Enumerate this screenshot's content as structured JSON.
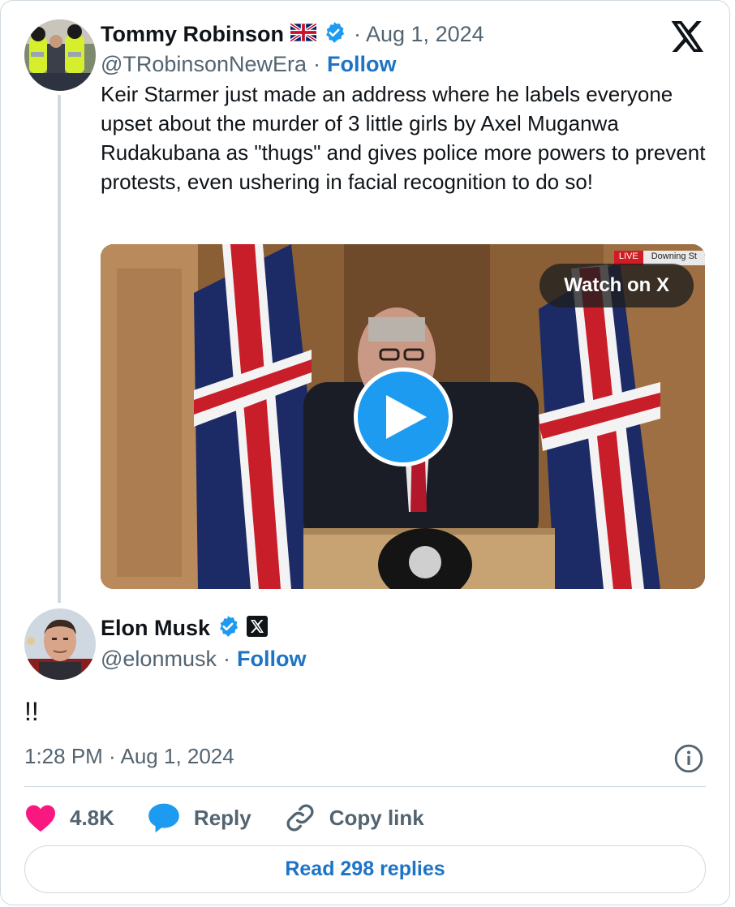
{
  "quoted_tweet": {
    "author_name": "Tommy Robinson",
    "flag_icon": "uk-flag-icon",
    "verified_icon": "verified-badge-icon",
    "date": "· Aug 1, 2024",
    "handle": "@TRobinsonNewEra",
    "separator": "·",
    "follow_label": "Follow",
    "text": "Keir Starmer just made an address where he labels everyone upset about the murder of 3 little girls by Axel Muganwa Rudakubana as \"thugs\" and gives police more powers to prevent protests, even ushering in facial recognition to do so!",
    "media": {
      "watch_label": "Watch on X",
      "live_label": "LIVE",
      "location_label": "Downing St"
    }
  },
  "tweet": {
    "author_name": "Elon Musk",
    "verified_icon": "verified-badge-icon",
    "affiliation_icon": "x-affiliation-icon",
    "handle": "@elonmusk",
    "separator": "·",
    "follow_label": "Follow",
    "text": "!!",
    "timestamp": "1:28 PM · Aug 1, 2024"
  },
  "actions": {
    "likes_count": "4.8K",
    "reply_label": "Reply",
    "copy_link_label": "Copy link"
  },
  "read_replies_label": "Read 298 replies",
  "colors": {
    "link_blue": "#1d74c6",
    "verified_blue": "#1d9bf0",
    "like_pink": "#f91880",
    "muted_gray": "#536471"
  }
}
